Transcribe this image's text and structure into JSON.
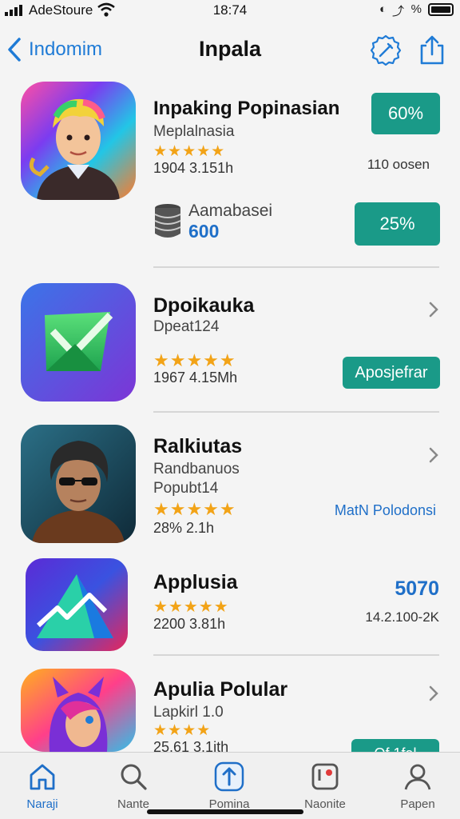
{
  "status_bar": {
    "carrier": "AdeStoure",
    "time": "18:74",
    "right_icons": [
      "location-icon",
      "alarm-icon",
      "do-not-disturb-icon",
      "battery-icon"
    ]
  },
  "nav": {
    "back_label": "Indomim",
    "title": "Inpala",
    "right_icons": [
      "edit-badge-icon",
      "share-icon"
    ]
  },
  "accent_color": "#1a9a88",
  "link_color": "#1f6fc8",
  "apps": [
    {
      "name": "Inpaking Popinasian",
      "subtitle": "Meplalnasia",
      "rating_stars": 5,
      "meta": "1904 3.151h",
      "right_meta": "110 oosen",
      "button": "60%",
      "extra": {
        "icon": "database-icon",
        "label": "Aamabasei",
        "value": "600",
        "button": "25%"
      }
    },
    {
      "name": "Dpoikauka",
      "subtitle": "Dpeat124",
      "rating_stars": 5,
      "meta": "1967 4.15Mh",
      "button": "Aposjefrar"
    },
    {
      "name": "Ralkiutas",
      "subtitle": "Randbanuos",
      "subtitle2": "Popubt14",
      "rating_stars": 5,
      "meta": "28% 2.1h",
      "link": "MatN Polodonsi"
    },
    {
      "name": "Applusia",
      "rating_stars": 5,
      "meta": "2200 3.81h",
      "right_value": "5070",
      "right_meta": "14.2.100-2K"
    },
    {
      "name": "Apulia Polular",
      "subtitle": "Lapkirl 1.0",
      "rating_stars": 4,
      "meta": "25.61 3.1ith",
      "button": "Of 1fal"
    }
  ],
  "tabs": [
    {
      "label": "Naraji",
      "icon": "home-icon",
      "active": true
    },
    {
      "label": "Nante",
      "icon": "search-icon",
      "active": false
    },
    {
      "label": "Pomina",
      "icon": "upload-icon",
      "active": false
    },
    {
      "label": "Naonite",
      "icon": "notification-icon",
      "active": false
    },
    {
      "label": "Papen",
      "icon": "person-icon",
      "active": false
    }
  ]
}
